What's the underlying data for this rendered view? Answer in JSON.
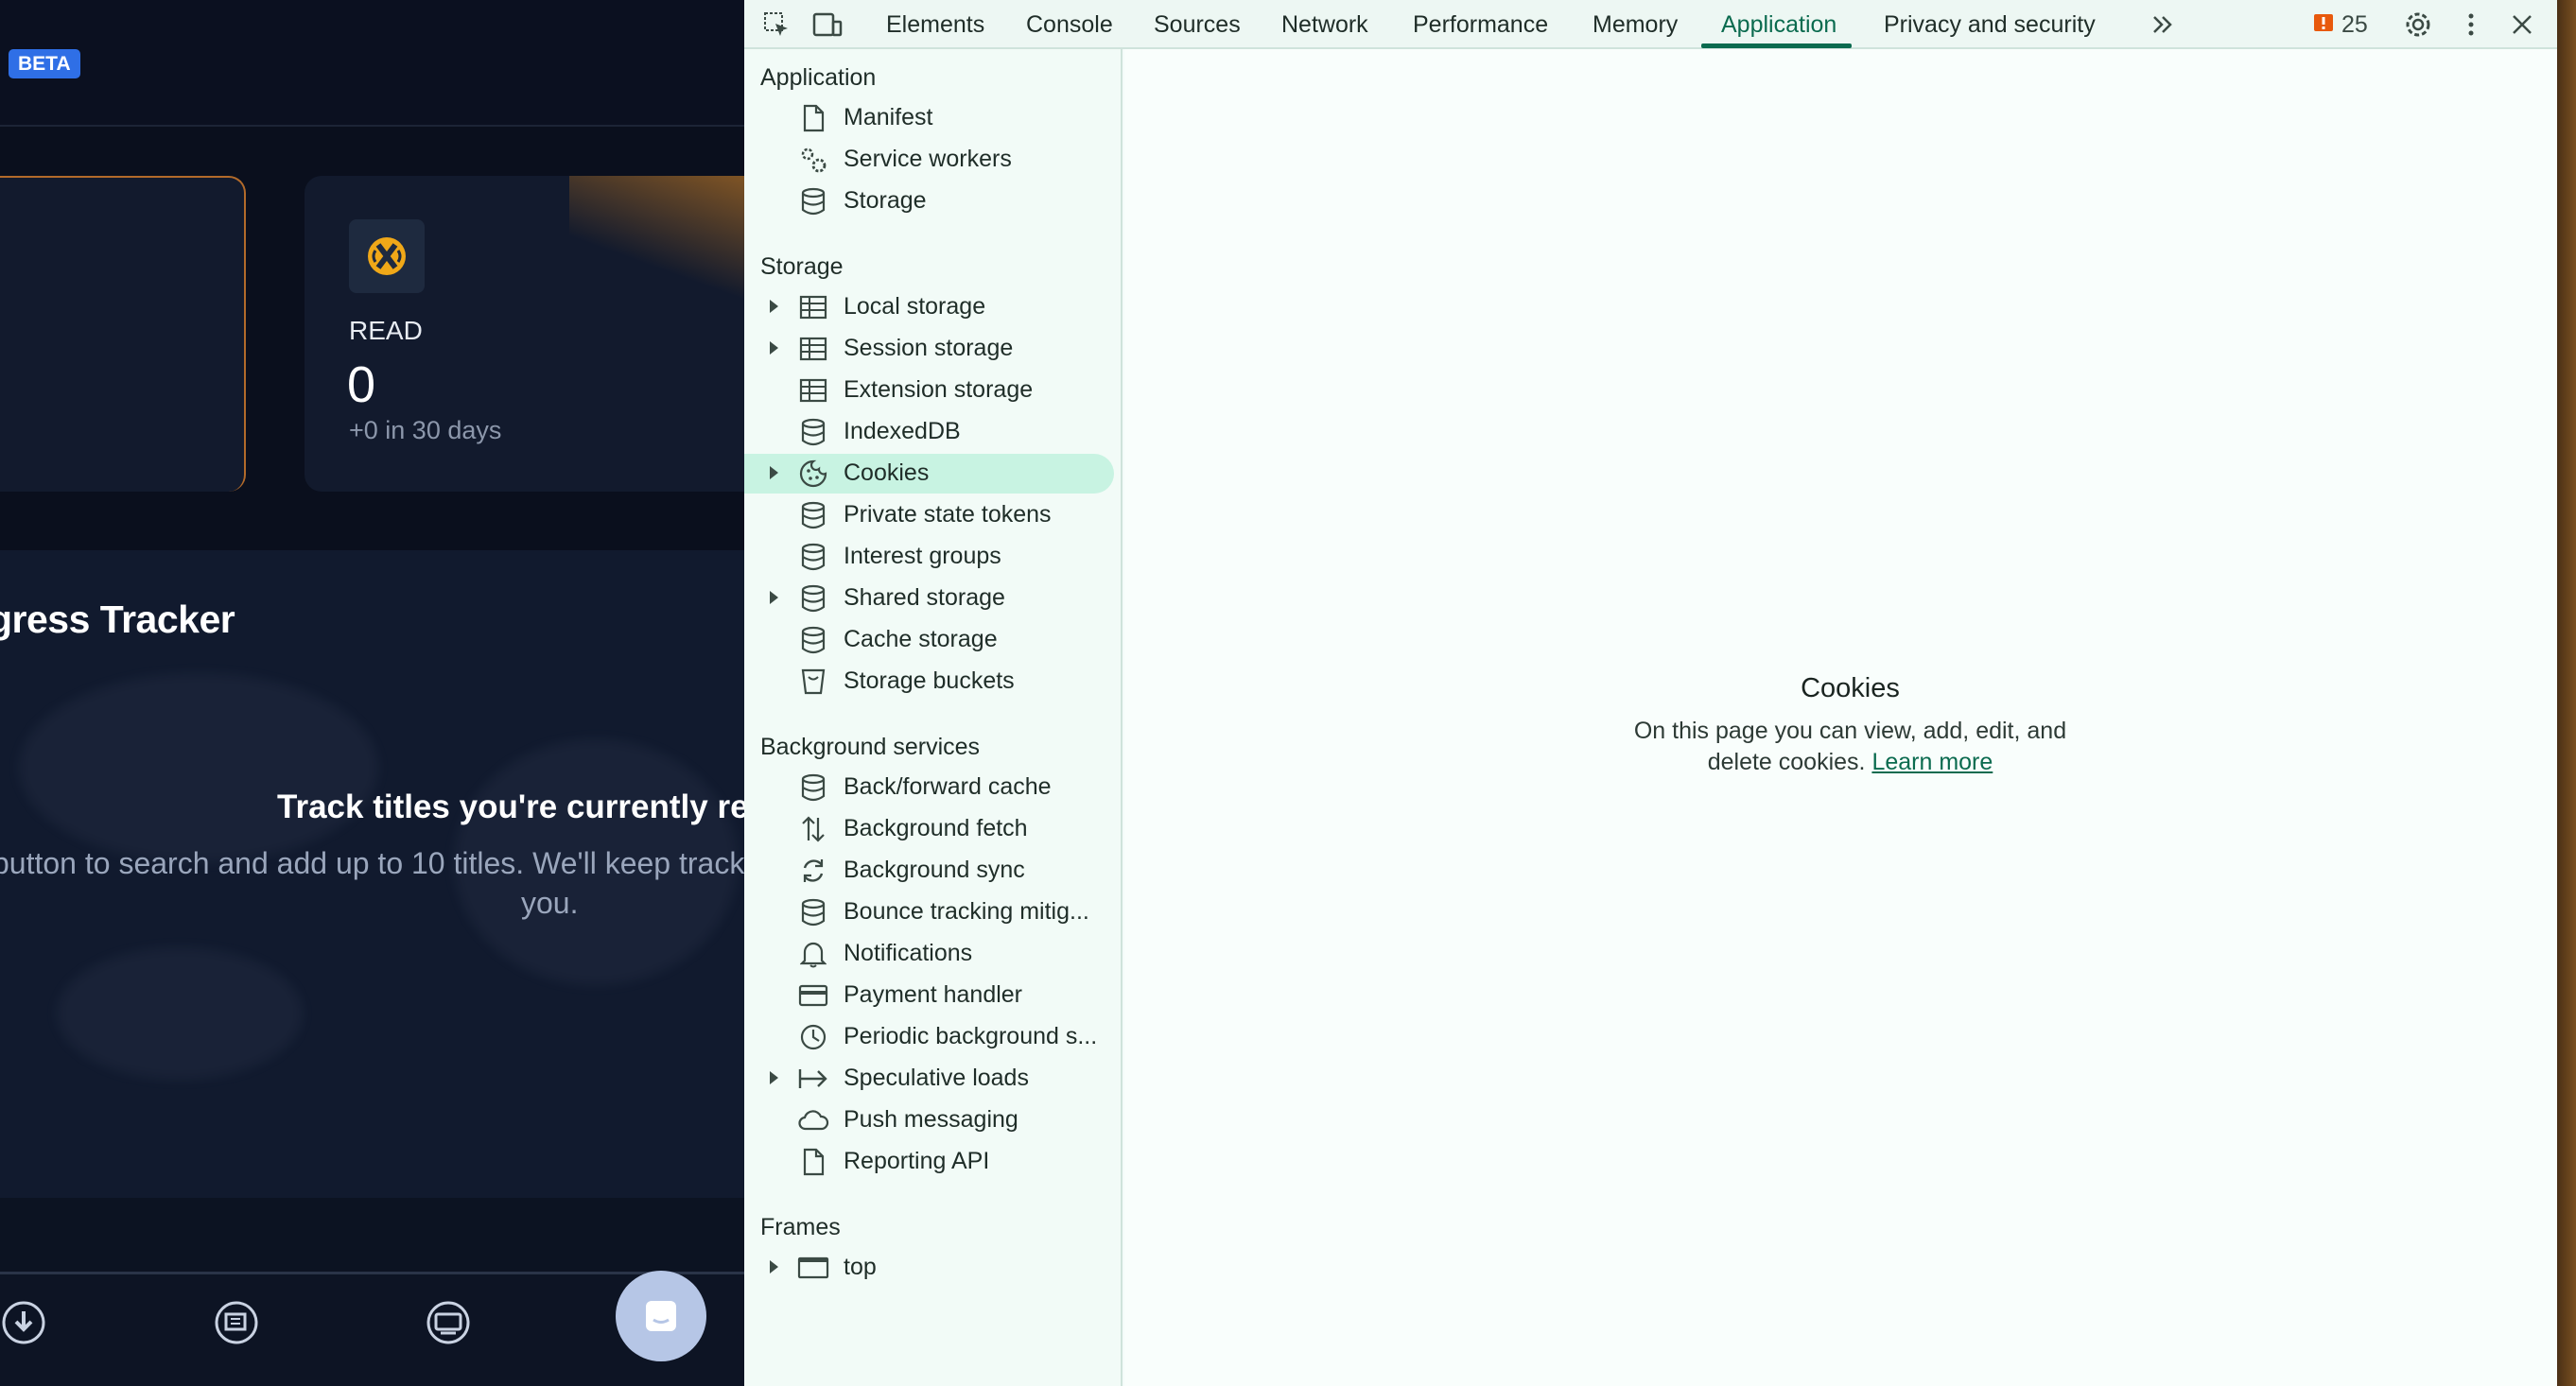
{
  "app": {
    "badge": "BETA",
    "stat": {
      "label": "READ",
      "value": "0",
      "change": "+0 in 30 days"
    },
    "tracker": {
      "title": "gress Tracker",
      "empty_title": "Track titles you're currently rea",
      "empty_desc_line1": "button to search and add up to 10 titles. We'll keep track o",
      "empty_desc_line2": "you."
    },
    "bottom_nav_icons": [
      "downloads-icon",
      "library-icon",
      "discussions-icon",
      "chat-fab-icon"
    ]
  },
  "devtools": {
    "tabs": [
      "Elements",
      "Console",
      "Sources",
      "Network",
      "Performance",
      "Memory",
      "Application",
      "Privacy and security"
    ],
    "active_tab": "Application",
    "issues_count": "25",
    "sidebar": {
      "sections": [
        {
          "title": "Application",
          "items": [
            {
              "label": "Manifest",
              "icon": "file-icon",
              "expandable": false
            },
            {
              "label": "Service workers",
              "icon": "gears-icon",
              "expandable": false
            },
            {
              "label": "Storage",
              "icon": "database-icon",
              "expandable": false
            }
          ]
        },
        {
          "title": "Storage",
          "items": [
            {
              "label": "Local storage",
              "icon": "table-icon",
              "expandable": true
            },
            {
              "label": "Session storage",
              "icon": "table-icon",
              "expandable": true
            },
            {
              "label": "Extension storage",
              "icon": "table-icon",
              "expandable": false
            },
            {
              "label": "IndexedDB",
              "icon": "database-icon",
              "expandable": false
            },
            {
              "label": "Cookies",
              "icon": "cookie-icon",
              "expandable": true,
              "selected": true
            },
            {
              "label": "Private state tokens",
              "icon": "database-icon",
              "expandable": false
            },
            {
              "label": "Interest groups",
              "icon": "database-icon",
              "expandable": false
            },
            {
              "label": "Shared storage",
              "icon": "database-icon",
              "expandable": true
            },
            {
              "label": "Cache storage",
              "icon": "database-icon",
              "expandable": false
            },
            {
              "label": "Storage buckets",
              "icon": "bucket-icon",
              "expandable": false
            }
          ]
        },
        {
          "title": "Background services",
          "items": [
            {
              "label": "Back/forward cache",
              "icon": "database-icon",
              "expandable": false
            },
            {
              "label": "Background fetch",
              "icon": "arrows-updown-icon",
              "expandable": false
            },
            {
              "label": "Background sync",
              "icon": "sync-icon",
              "expandable": false
            },
            {
              "label": "Bounce tracking mitig...",
              "icon": "database-icon",
              "expandable": false
            },
            {
              "label": "Notifications",
              "icon": "bell-icon",
              "expandable": false
            },
            {
              "label": "Payment handler",
              "icon": "credit-card-icon",
              "expandable": false
            },
            {
              "label": "Periodic background s...",
              "icon": "clock-icon",
              "expandable": false
            },
            {
              "label": "Speculative loads",
              "icon": "arrow-right-bar-icon",
              "expandable": true
            },
            {
              "label": "Push messaging",
              "icon": "cloud-icon",
              "expandable": false
            },
            {
              "label": "Reporting API",
              "icon": "file-icon",
              "expandable": false
            }
          ]
        },
        {
          "title": "Frames",
          "items": [
            {
              "label": "top",
              "icon": "frame-icon",
              "expandable": true
            }
          ]
        }
      ]
    },
    "main": {
      "title": "Cookies",
      "desc_line1": "On this page you can view, add, edit, and",
      "desc_line2": "delete cookies.",
      "link": "Learn more"
    },
    "colors": {
      "accent": "#0b6b4f",
      "selected_bg": "#c8f3e2",
      "issue_badge": "#e8590c"
    }
  }
}
